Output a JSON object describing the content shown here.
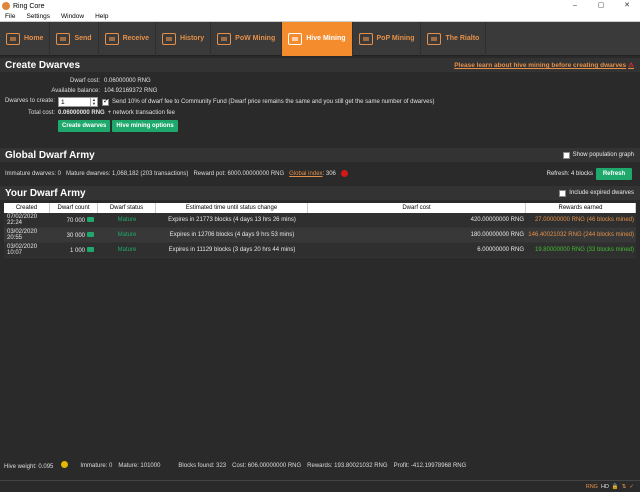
{
  "window": {
    "title": "Ring Core",
    "minimize": "–",
    "maximize": "▢",
    "close": "✕"
  },
  "menu": [
    "File",
    "Settings",
    "Window",
    "Help"
  ],
  "nav": [
    {
      "label": "Home",
      "icon": "home-icon"
    },
    {
      "label": "Send",
      "icon": "send-icon"
    },
    {
      "label": "Receive",
      "icon": "receive-icon"
    },
    {
      "label": "History",
      "icon": "history-icon"
    },
    {
      "label": "PoW Mining",
      "icon": "pow-mining-icon"
    },
    {
      "label": "Hive Mining",
      "icon": "diamond-icon",
      "active": true
    },
    {
      "label": "PoP Mining",
      "icon": "pop-mining-icon"
    },
    {
      "label": "The Rialto",
      "icon": "rialto-icon"
    }
  ],
  "create": {
    "title": "Create Dwarves",
    "warning_link": "Please learn about hive mining before creating dwarves",
    "dwarf_cost_label": "Dwarf cost:",
    "dwarf_cost_value": "0.06000000 RNG",
    "balance_label": "Available balance:",
    "balance_value": "104.92169372 RNG",
    "to_create_label": "Dwarves to create:",
    "to_create_value": "1",
    "community_fund_text": "Send 10% of dwarf fee to Community Fund (Dwarf price remains the same and you still get the same number of dwarves)",
    "total_cost_label": "Total cost:",
    "total_cost_value": "0.06000000 RNG",
    "total_cost_note": "+ network transaction fee",
    "create_button": "Create dwarves",
    "options_button": "Hive mining options"
  },
  "global": {
    "title": "Global Dwarf Army",
    "show_population": "Show population graph",
    "immature": "Immature dwarves: 0",
    "mature": "Mature dwarves: 1,068,182 (203 transactions)",
    "reward_pot": "Reward pot: 6000.00000000 RNG",
    "global_index_link": "Global index",
    "global_index_value": ": 306",
    "refresh_label": "Refresh: 4 blocks",
    "refresh_button": "Refresh"
  },
  "army": {
    "title": "Your Dwarf Army",
    "include_expired": "Include expired dwarves",
    "columns": [
      "Created",
      "Dwarf count",
      "Dwarf status",
      "Estimated time until status change",
      "Dwarf cost",
      "Rewards earned"
    ],
    "rows": [
      {
        "created": "07/02/2020 22:24",
        "count": "70 000",
        "status": "Mature",
        "eta": "Expires in 21773 blocks (4 days 13 hrs 26 mins)",
        "cost": "420.00000000 RNG",
        "rewards": "27.00000000 RNG (46 blocks mined)",
        "rewards_color": "orange"
      },
      {
        "created": "03/02/2020 20:55",
        "count": "30 000",
        "status": "Mature",
        "eta": "Expires in 12706 blocks (4 days 9 hrs 53 mins)",
        "cost": "180.00000000 RNG",
        "rewards": "146.40021032 RNG (244 blocks mined)",
        "rewards_color": "orange"
      },
      {
        "created": "03/02/2020 10:07",
        "count": "1 000",
        "status": "Mature",
        "eta": "Expires in 11129 blocks (3 days 20 hrs 44 mins)",
        "cost": "6.00000000 RNG",
        "rewards": "19.80000000 RNG (33 blocks mined)",
        "rewards_color": "lime"
      }
    ]
  },
  "footer": {
    "hive_weight": "Hive weight: 0.095",
    "immature": "Immature: 0",
    "mature": "Mature: 101000",
    "blocks_found": "Blocks found: 323",
    "cost": "Cost: 606.00000000 RNG",
    "rewards": "Rewards: 193.80021032 RNG",
    "profit": "Profit: -412.19978968 RNG"
  },
  "status": {
    "unit": "RNG",
    "hd": "HD"
  },
  "colors": {
    "accent": "#f48b2c",
    "green": "#1ea86b",
    "bg": "#2a2a2a"
  }
}
